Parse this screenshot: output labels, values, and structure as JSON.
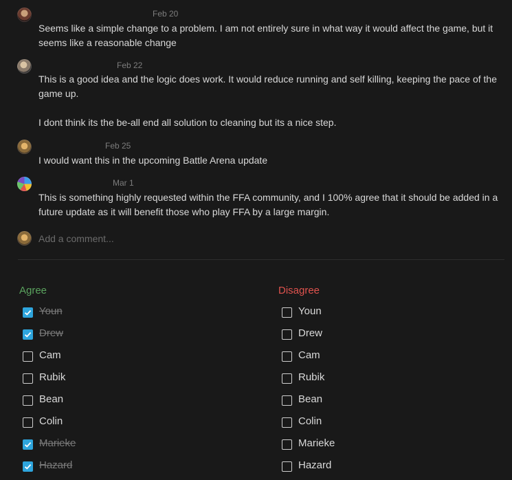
{
  "comments": [
    {
      "date": "Feb 20",
      "paragraphs": [
        "Seems like a simple change to a problem. I am not entirely sure in what way it would affect the game, but it seems like a reasonable change"
      ]
    },
    {
      "date": "Feb 22",
      "paragraphs": [
        "This is a good idea and the logic does work. It would reduce running and self killing, keeping the pace of the game up.",
        "I dont think its the be-all end all solution to cleaning but its a nice step."
      ]
    },
    {
      "date": "Feb 25",
      "paragraphs": [
        "I would want this in the upcoming Battle Arena update"
      ]
    },
    {
      "date": "Mar 1",
      "paragraphs": [
        "This is something highly requested within the FFA community, and I 100% agree that it should be added in a future update as it will benefit those who play FFA by a large margin."
      ]
    }
  ],
  "add_comment": {
    "placeholder": "Add a comment..."
  },
  "colors": {
    "agree": "#5aa35e",
    "disagree": "#e0534e",
    "checkbox_checked": "#2ea5dd"
  },
  "agree": {
    "title": "Agree",
    "items": [
      {
        "label": "Youn",
        "checked": true
      },
      {
        "label": "Drew",
        "checked": true
      },
      {
        "label": "Cam",
        "checked": false
      },
      {
        "label": "Rubik",
        "checked": false
      },
      {
        "label": "Bean",
        "checked": false
      },
      {
        "label": "Colin",
        "checked": false
      },
      {
        "label": "Marieke",
        "checked": true
      },
      {
        "label": "Hazard",
        "checked": true
      }
    ]
  },
  "disagree": {
    "title": "Disagree",
    "items": [
      {
        "label": "Youn",
        "checked": false
      },
      {
        "label": "Drew",
        "checked": false
      },
      {
        "label": "Cam",
        "checked": false
      },
      {
        "label": "Rubik",
        "checked": false
      },
      {
        "label": "Bean",
        "checked": false
      },
      {
        "label": "Colin",
        "checked": false
      },
      {
        "label": "Marieke",
        "checked": false
      },
      {
        "label": "Hazard",
        "checked": false
      }
    ]
  }
}
